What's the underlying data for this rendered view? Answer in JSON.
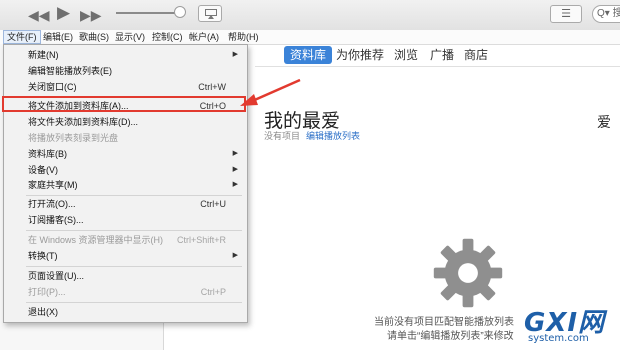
{
  "toolbar": {
    "rewind_icon": "rewind-icon",
    "play_icon": "play-icon",
    "forward_icon": "fast-forward-icon",
    "list_glyph": "☰",
    "search_text": "Q▾ 搜"
  },
  "menubar": {
    "items": [
      "文件(F)",
      "编辑(E)",
      "歌曲(S)",
      "显示(V)",
      "控制(C)",
      "帐户(A)",
      "帮助(H)"
    ]
  },
  "nav": {
    "tabs": [
      "资料库",
      "为你推荐",
      "浏览",
      "广播",
      "商店"
    ],
    "selected": "资料库"
  },
  "main": {
    "title": "我的最爱",
    "subtitle": "没有项目",
    "edit_link": "编辑播放列表",
    "right_label": "爱",
    "empty_line1": "当前没有项目匹配智能播放列表",
    "empty_line2": "请单击“编辑播放列表”来修改"
  },
  "file_menu": {
    "items": [
      {
        "label": "新建(N)",
        "shortcut": "",
        "submenu": true,
        "disabled": false
      },
      {
        "label": "编辑智能播放列表(E)",
        "shortcut": "",
        "submenu": false,
        "disabled": false
      },
      {
        "label": "关闭窗口(C)",
        "shortcut": "Ctrl+W",
        "submenu": false,
        "disabled": false
      },
      {
        "label": "将文件添加到资料库(A)...",
        "shortcut": "Ctrl+O",
        "submenu": false,
        "disabled": false,
        "highlighted": true
      },
      {
        "label": "将文件夹添加到资料库(D)...",
        "shortcut": "",
        "submenu": false,
        "disabled": false
      },
      {
        "label": "将播放列表刻录到光盘",
        "shortcut": "",
        "submenu": false,
        "disabled": true
      },
      {
        "label": "资料库(B)",
        "shortcut": "",
        "submenu": true,
        "disabled": false
      },
      {
        "label": "设备(V)",
        "shortcut": "",
        "submenu": true,
        "disabled": false
      },
      {
        "label": "家庭共享(M)",
        "shortcut": "",
        "submenu": true,
        "disabled": false
      },
      {
        "label": "打开流(O)...",
        "shortcut": "Ctrl+U",
        "submenu": false,
        "disabled": false
      },
      {
        "label": "订阅播客(S)...",
        "shortcut": "",
        "submenu": false,
        "disabled": false
      },
      {
        "label": "在 Windows 资源管理器中显示(H)",
        "shortcut": "Ctrl+Shift+R",
        "submenu": false,
        "disabled": true
      },
      {
        "label": "转换(T)",
        "shortcut": "",
        "submenu": true,
        "disabled": false
      },
      {
        "label": "页面设置(U)...",
        "shortcut": "",
        "submenu": false,
        "disabled": false
      },
      {
        "label": "打印(P)...",
        "shortcut": "Ctrl+P",
        "submenu": false,
        "disabled": true
      },
      {
        "label": "退出(X)",
        "shortcut": "",
        "submenu": false,
        "disabled": false
      }
    ]
  },
  "watermark": {
    "main": "GXI网",
    "sub": "system.com"
  },
  "colors": {
    "accent": "#3b83d8",
    "highlight_border": "#e23a2f",
    "link": "#2b6fc7"
  }
}
